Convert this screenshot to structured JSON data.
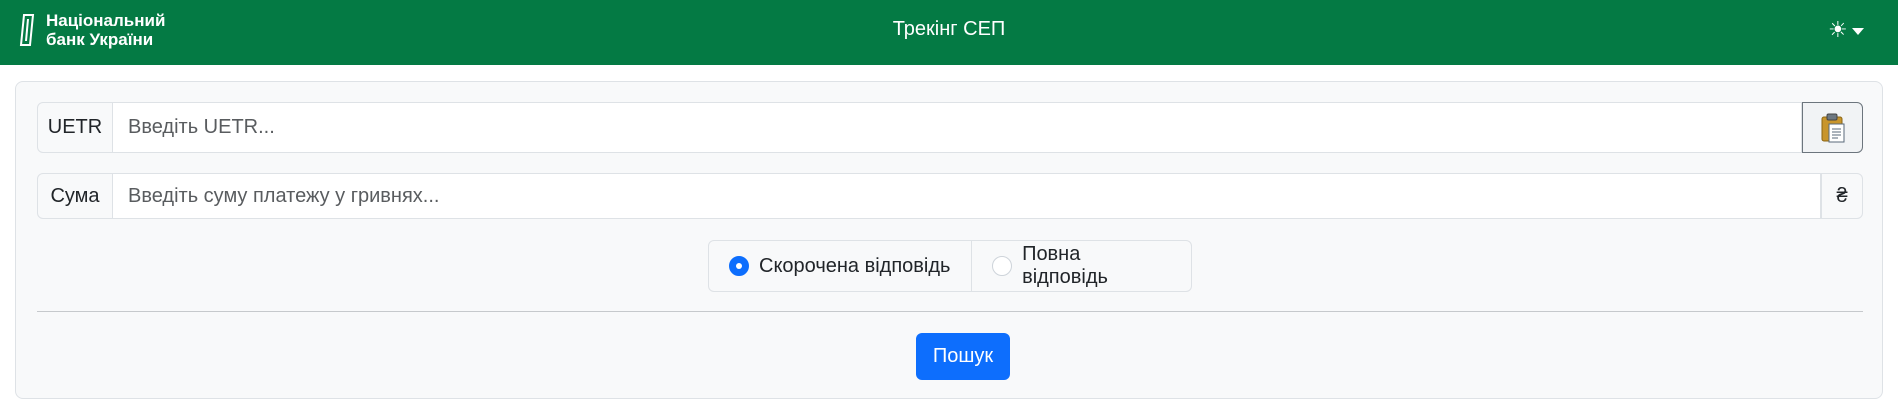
{
  "navbar": {
    "brand_line1": "Національний",
    "brand_line2": "банк України",
    "title": "Трекінг СЕП",
    "theme_icon": "sun-icon",
    "background": "#047a44"
  },
  "form": {
    "uetr": {
      "label": "UETR",
      "value": "",
      "placeholder": "Введіть UETR...",
      "paste_icon": "clipboard-icon"
    },
    "amount": {
      "label": "Сума",
      "value": "",
      "placeholder": "Введіть суму платежу у гривнях...",
      "currency": "₴"
    },
    "response_mode": {
      "options": [
        {
          "label": "Скорочена відповідь",
          "checked": true
        },
        {
          "label": "Повна відповідь",
          "checked": false
        }
      ]
    },
    "search_label": "Пошук"
  },
  "colors": {
    "accent": "#0d6efd",
    "brand_green": "#047a44"
  }
}
